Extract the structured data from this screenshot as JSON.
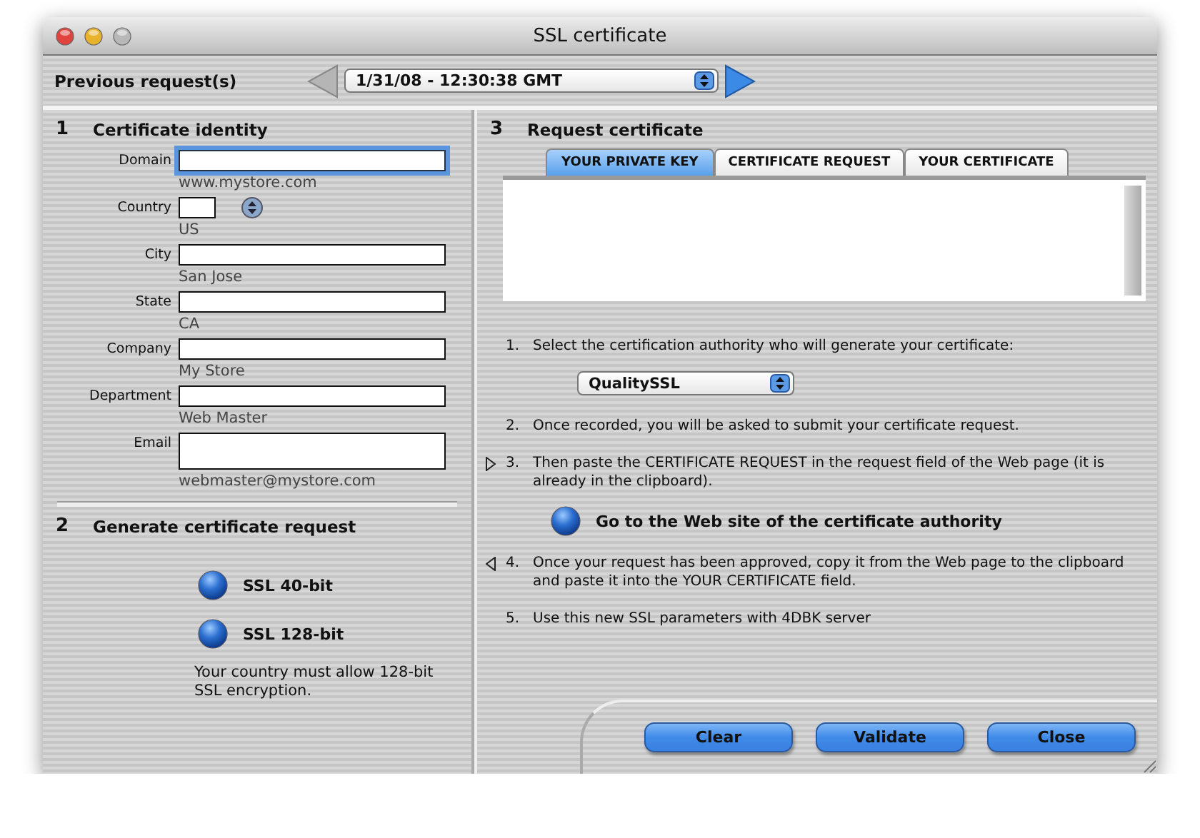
{
  "window": {
    "title": "SSL certificate"
  },
  "previous_requests": {
    "label": "Previous request(s)",
    "value": "1/31/08 - 12:30:38 GMT",
    "back_disabled": true,
    "forward_disabled": false
  },
  "identity": {
    "number": "1",
    "title": "Certificate identity",
    "fields": [
      {
        "label": "Domain",
        "kind": "text",
        "focused": true,
        "hint": "www.mystore.com"
      },
      {
        "label": "Country",
        "kind": "short",
        "focused": false,
        "hint": "US"
      },
      {
        "label": "City",
        "kind": "text",
        "focused": false,
        "hint": "San Jose"
      },
      {
        "label": "State",
        "kind": "text",
        "focused": false,
        "hint": "CA"
      },
      {
        "label": "Company",
        "kind": "text",
        "focused": false,
        "hint": "My Store"
      },
      {
        "label": "Department",
        "kind": "text",
        "focused": false,
        "hint": "Web Master"
      },
      {
        "label": "Email",
        "kind": "multiline",
        "focused": false,
        "hint": "webmaster@mystore.com"
      }
    ]
  },
  "generate": {
    "number": "2",
    "title": "Generate certificate request",
    "options": [
      "SSL 40-bit",
      "SSL 128-bit"
    ],
    "note": "Your country must allow 128-bit SSL encryption."
  },
  "request": {
    "number": "3",
    "title": "Request certificate",
    "tabs": [
      {
        "label": "YOUR PRIVATE KEY",
        "selected": true
      },
      {
        "label": "CERTIFICATE REQUEST",
        "selected": false
      },
      {
        "label": "YOUR CERTIFICATE",
        "selected": false
      }
    ],
    "steps": [
      {
        "kind": "step",
        "number": "1.",
        "text": "Select the certification authority who will generate your certificate:"
      },
      {
        "kind": "dropdown",
        "value": "QualitySSL"
      },
      {
        "kind": "step",
        "number": "2.",
        "text": "Once recorded, you will be asked to submit your certificate request."
      },
      {
        "kind": "forwardstep",
        "number": "3.",
        "text": "Then paste the CERTIFICATE REQUEST in the request field of the Web page (it is already in the clipboard)."
      },
      {
        "kind": "action",
        "label": "Go to the Web site of the certificate authority"
      },
      {
        "kind": "backstep",
        "number": "4.",
        "text": "Once your request has been approved, copy it from the Web page to the clipboard and paste it into the YOUR CERTIFICATE field."
      },
      {
        "kind": "step",
        "number": "5.",
        "text": "Use this new SSL parameters with 4DBK server"
      }
    ]
  },
  "buttons": [
    "Clear",
    "Validate",
    "Close"
  ]
}
